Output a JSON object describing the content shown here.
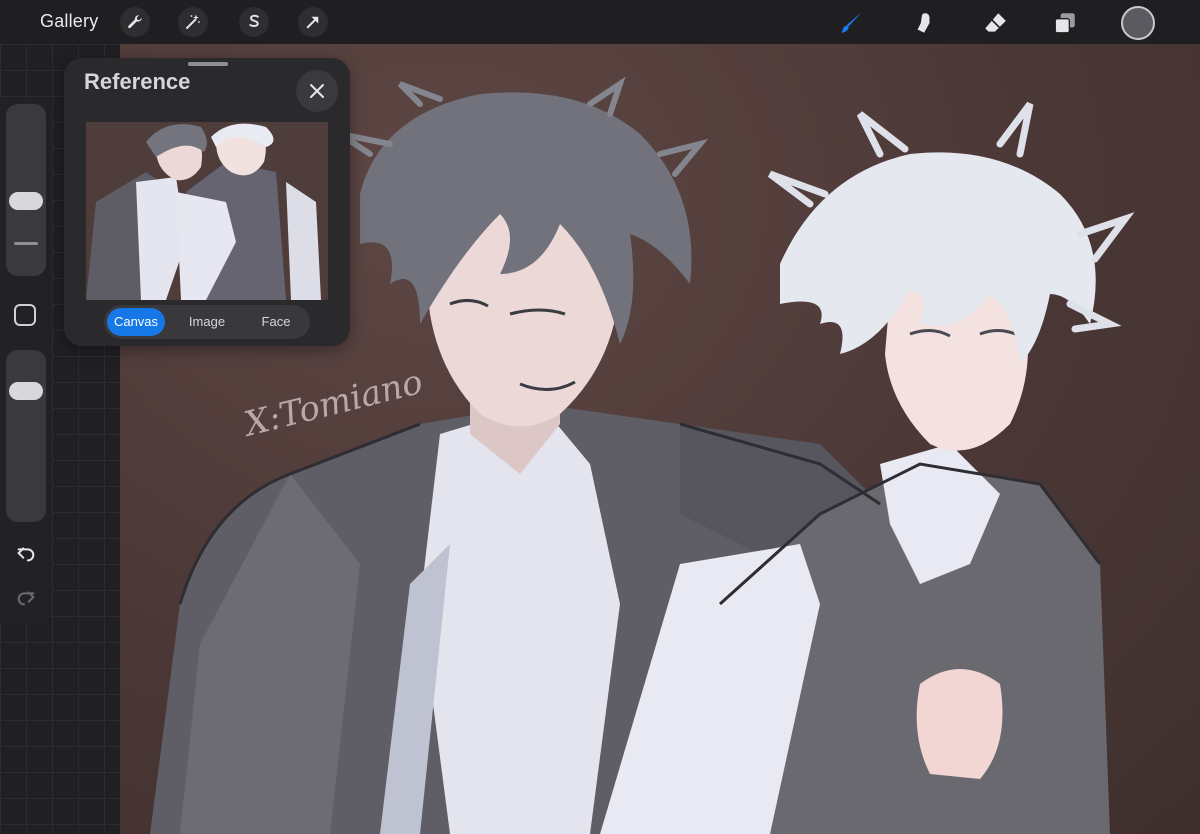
{
  "topbar": {
    "gallery_label": "Gallery",
    "actions": [
      {
        "icon": "wrench-icon"
      },
      {
        "icon": "magic-wand-icon"
      },
      {
        "icon": "selection-s-icon"
      },
      {
        "icon": "transform-arrow-icon"
      }
    ],
    "tools": [
      {
        "icon": "brush-icon",
        "active": true
      },
      {
        "icon": "smudge-icon",
        "active": false
      },
      {
        "icon": "eraser-icon",
        "active": false
      },
      {
        "icon": "layers-icon",
        "active": false
      }
    ],
    "current_color": "#5a5a60",
    "accent_color": "#1a7cf0"
  },
  "sidebar": {
    "brush_size_level": 0.42,
    "opacity_level": 0.82
  },
  "reference": {
    "title": "Reference",
    "tabs": [
      "Canvas",
      "Image",
      "Face"
    ],
    "active_tab": "Canvas"
  },
  "artwork": {
    "signature": "X:Tomiano"
  }
}
